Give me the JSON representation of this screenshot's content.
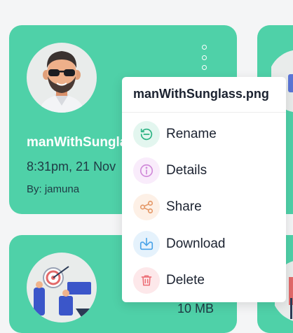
{
  "cards": [
    {
      "title": "manWithSunglass.png",
      "date": "8:31pm, 21 Nov",
      "author": "By: jamuna"
    },
    {
      "size": "10 MB"
    }
  ],
  "context_menu": {
    "filename": "manWithSunglass.png",
    "items": [
      {
        "label": "Rename",
        "icon": "rename-icon",
        "color": "#2bb383",
        "bg": "#e3f6ef"
      },
      {
        "label": "Details",
        "icon": "info-icon",
        "color": "#d08ad9",
        "bg": "#f9ecfb"
      },
      {
        "label": "Share",
        "icon": "share-icon",
        "color": "#e59a6a",
        "bg": "#fdf0e6"
      },
      {
        "label": "Download",
        "icon": "download-icon",
        "color": "#4aa3e8",
        "bg": "#e5f2fc"
      },
      {
        "label": "Delete",
        "icon": "trash-icon",
        "color": "#ec6b73",
        "bg": "#fde8ea"
      }
    ]
  },
  "colors": {
    "card": "#4fd1a8",
    "text_dark": "#1f3a44",
    "background": "#f4f5f6"
  }
}
